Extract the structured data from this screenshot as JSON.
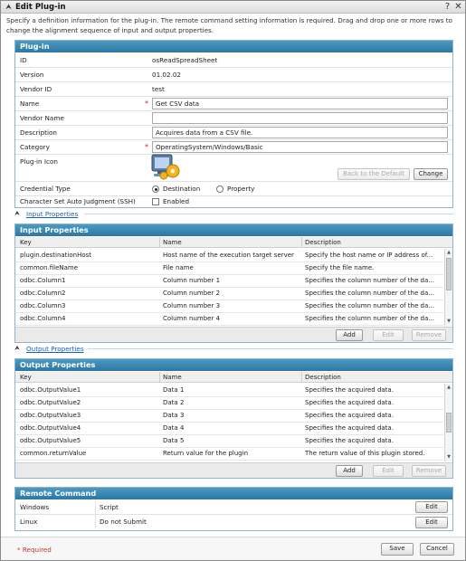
{
  "dialog": {
    "title": "Edit Plug-in"
  },
  "description": "Specify a definition information for the plug-in. The remote command setting information is required. Drag and drop one or more rows to change the alignment sequence of input and output properties.",
  "plugin": {
    "header": "Plug-in",
    "fields": [
      {
        "label": "ID",
        "value": "osReadSpreadSheet"
      },
      {
        "label": "Version",
        "value": "01.02.02"
      },
      {
        "label": "Vendor ID",
        "value": "test"
      },
      {
        "label": "Name",
        "value": "Get CSV data"
      },
      {
        "label": "Vendor Name",
        "value": ""
      },
      {
        "label": "Description",
        "value": "Acquires data from a CSV file."
      },
      {
        "label": "Category",
        "value": "OperatingSystem/Windows/Basic"
      },
      {
        "label": "Plug-in Icon"
      },
      {
        "label": "Credential Type"
      },
      {
        "label": "Character Set Auto Judgment (SSH)"
      }
    ],
    "back_default_label": "Back to the Default",
    "change_label": "Change",
    "credential_options": [
      "Destination",
      "Property"
    ],
    "credential_selected": "Destination",
    "charset_label": "Enabled",
    "charset_checked": false
  },
  "input_properties": {
    "link": "Input Properties",
    "header": "Input Properties",
    "columns": [
      "Key",
      "Name",
      "Description"
    ],
    "rows": [
      [
        "plugin.destinationHost",
        "Host name of the execution target server",
        "Specify the host name or IP address of..."
      ],
      [
        "common.fileName",
        "File name",
        "Specify the file name."
      ],
      [
        "odbc.Column1",
        "Column number 1",
        "Specifies the column number of the da..."
      ],
      [
        "odbc.Column2",
        "Column number 2",
        "Specifies the column number of the da..."
      ],
      [
        "odbc.Column3",
        "Column number 3",
        "Specifies the column number of the da..."
      ],
      [
        "odbc.Column4",
        "Column number 4",
        "Specifies the column number of the da..."
      ]
    ],
    "buttons": {
      "add": "Add",
      "edit": "Edit",
      "remove": "Remove"
    }
  },
  "output_properties": {
    "link": "Output Properties",
    "header": "Output Properties",
    "columns": [
      "Key",
      "Name",
      "Description"
    ],
    "rows": [
      [
        "odbc.OutputValue1",
        "Data 1",
        "Specifies the acquired data."
      ],
      [
        "odbc.OutputValue2",
        "Data 2",
        "Specifies the acquired data."
      ],
      [
        "odbc.OutputValue3",
        "Data 3",
        "Specifies the acquired data."
      ],
      [
        "odbc.OutputValue4",
        "Data 4",
        "Specifies the acquired data."
      ],
      [
        "odbc.OutputValue5",
        "Data 5",
        "Specifies the acquired data."
      ],
      [
        "common.returnValue",
        "Return value for the plugin",
        "The return value of this plugin stored."
      ]
    ],
    "buttons": {
      "add": "Add",
      "edit": "Edit",
      "remove": "Remove"
    }
  },
  "remote_command": {
    "header": "Remote Command",
    "rows": [
      {
        "os": "Windows",
        "value": "Script",
        "edit": "Edit"
      },
      {
        "os": "Linux",
        "value": "Do not Submit",
        "edit": "Edit"
      }
    ]
  },
  "footer": {
    "required_note": "* Required",
    "save": "Save",
    "cancel": "Cancel"
  },
  "colors": {
    "panel_header": "#3a8bb8",
    "required": "#d22222",
    "link": "#1a5fb4"
  }
}
